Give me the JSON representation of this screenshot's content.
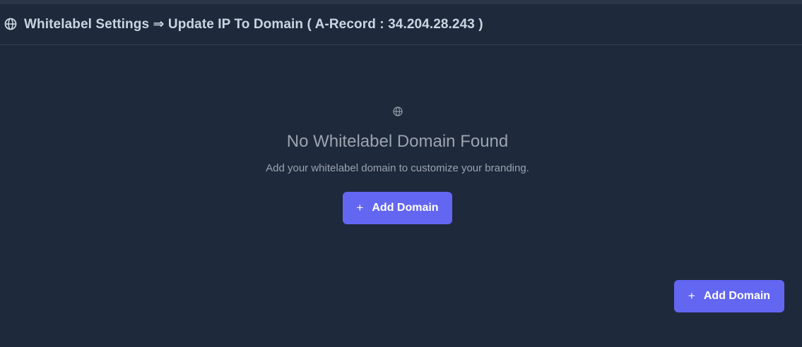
{
  "header": {
    "icon": "globe-icon",
    "title": "Whitelabel Settings ⇒ Update IP To Domain ( A-Record : 34.204.28.243 )"
  },
  "empty_state": {
    "icon": "globe-icon",
    "heading": "No Whitelabel Domain Found",
    "description": "Add your whitelabel domain to customize your branding.",
    "add_button": {
      "icon": "plus-icon",
      "plus": "+",
      "label": "Add Domain"
    }
  },
  "floating_button": {
    "icon": "plus-icon",
    "plus": "+",
    "label": "Add Domain"
  },
  "colors": {
    "background": "#1e293b",
    "accent": "#6366f1",
    "header_text": "#cbd5e1",
    "muted_text": "#9ca3af"
  }
}
